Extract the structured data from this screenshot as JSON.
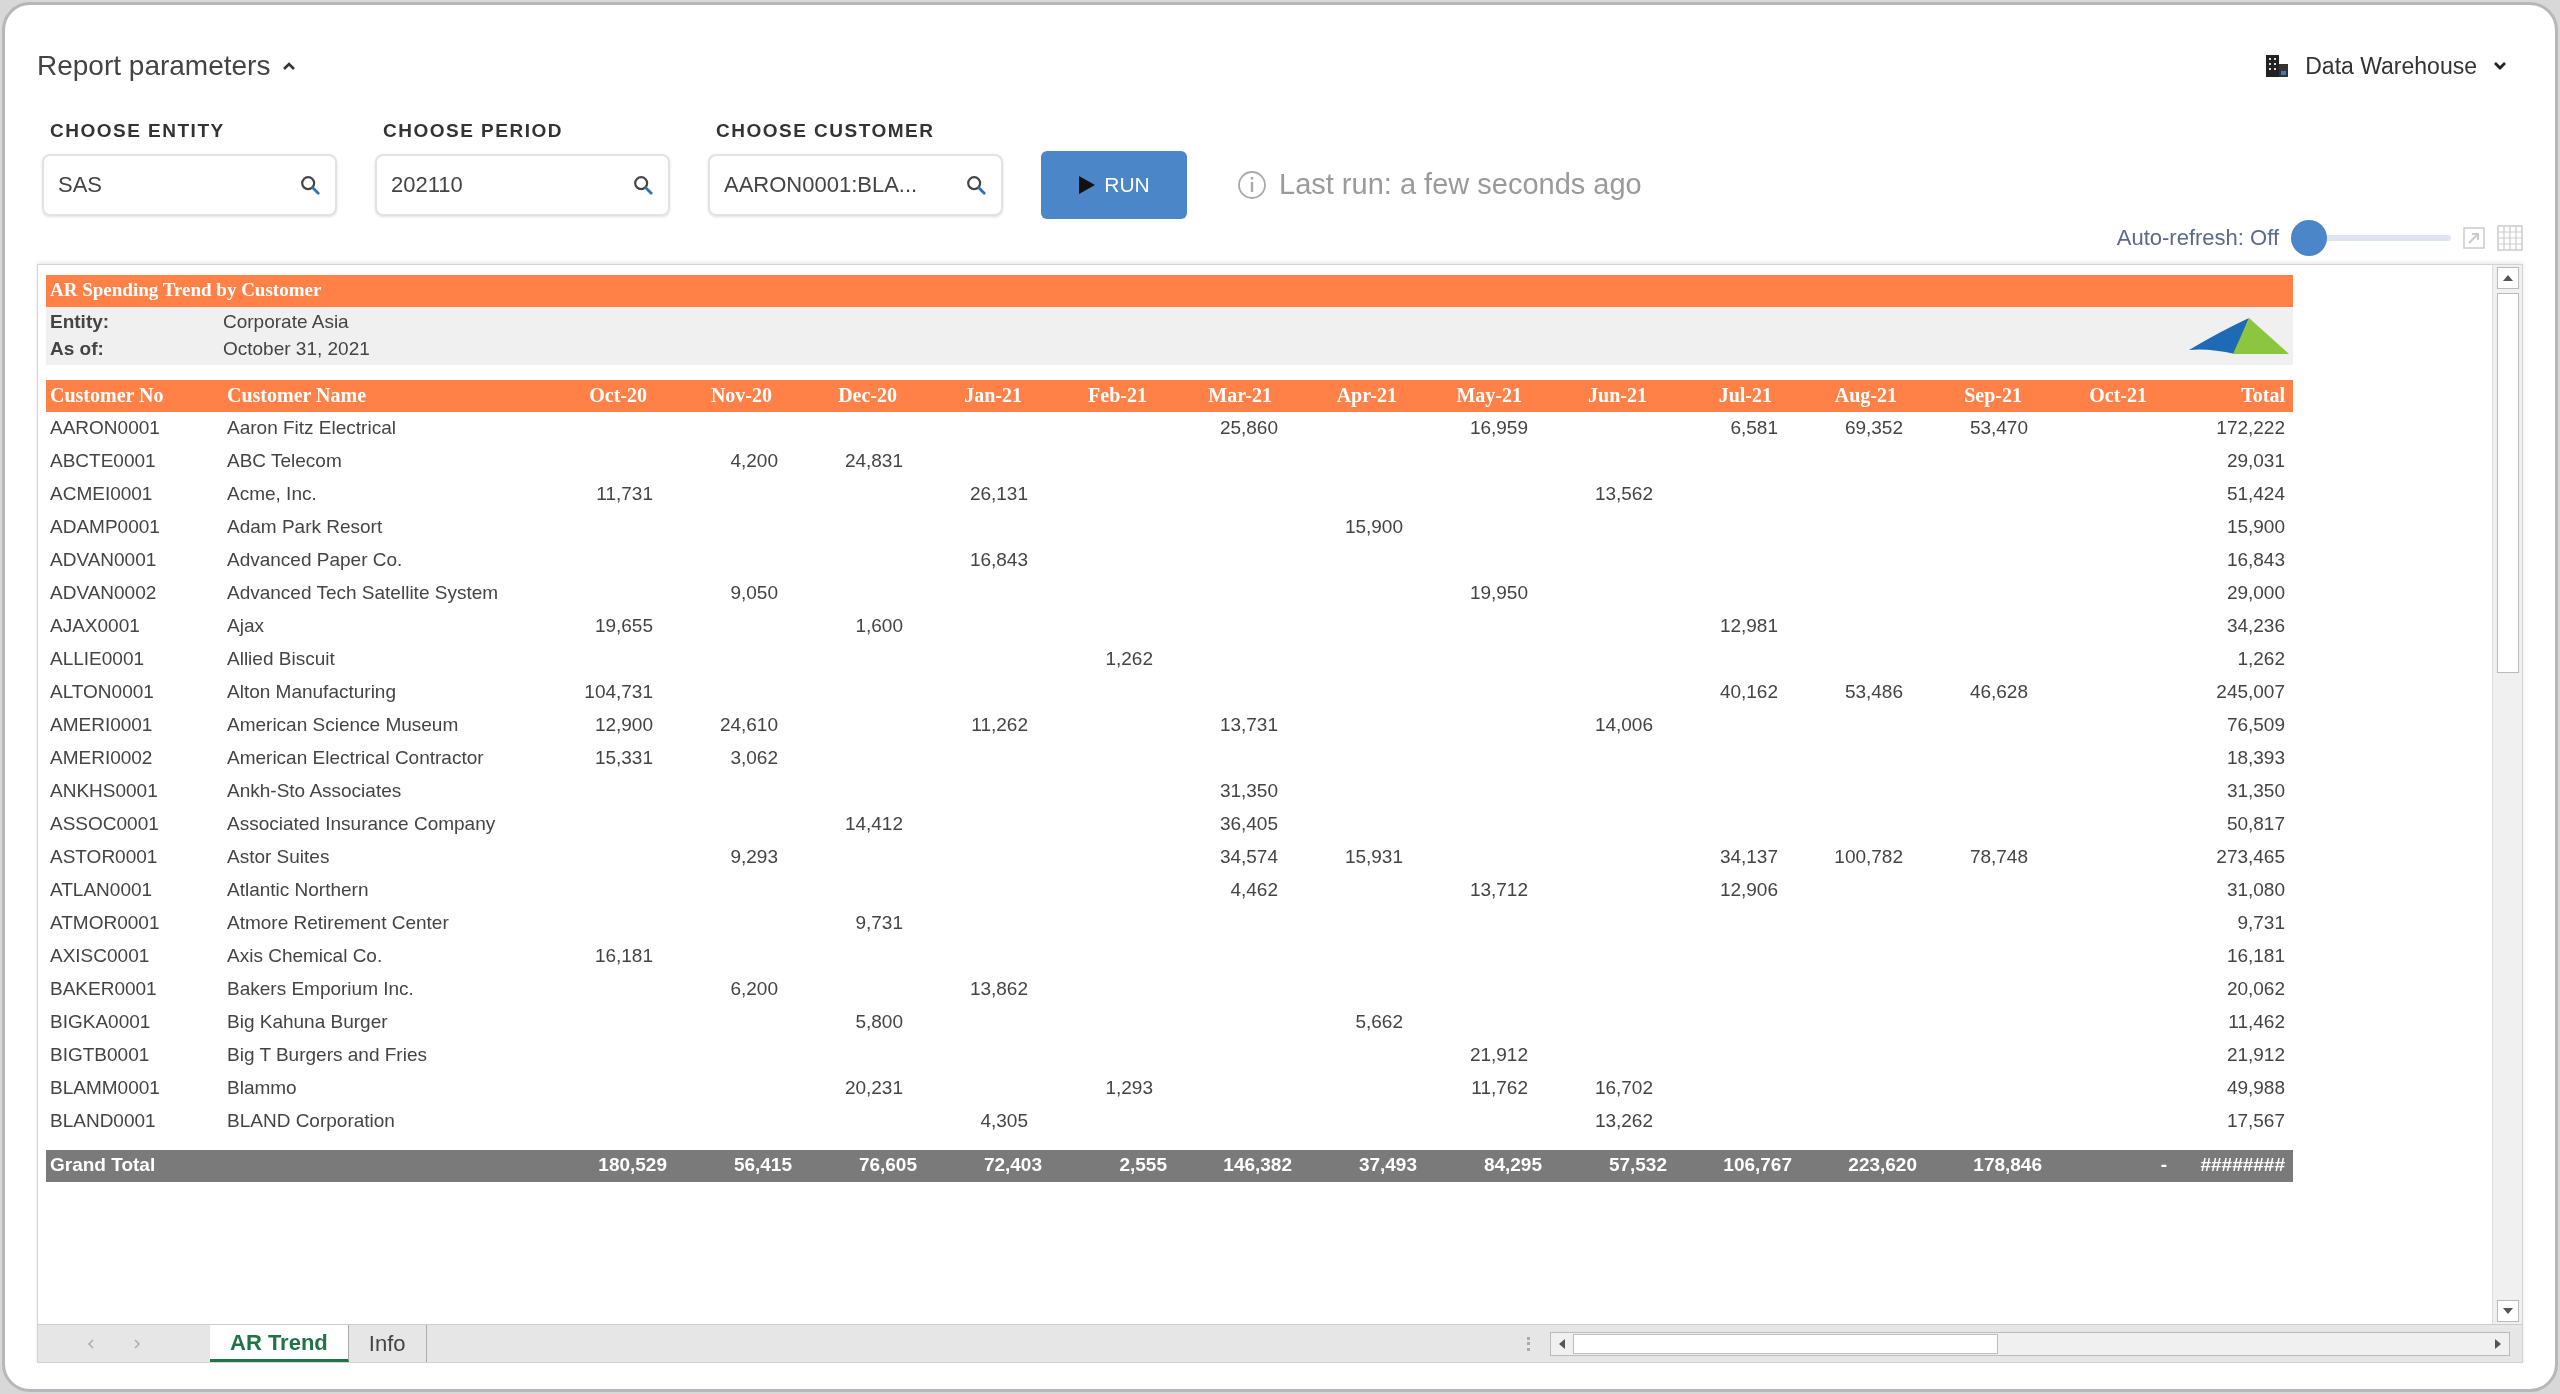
{
  "header": {
    "title": "Report parameters",
    "expanded": true,
    "source": "Data Warehouse"
  },
  "parameters": [
    {
      "label": "CHOOSE ENTITY",
      "value": "SAS"
    },
    {
      "label": "CHOOSE PERIOD",
      "value": "202110"
    },
    {
      "label": "CHOOSE CUSTOMER",
      "value": "AARON0001:BLA..."
    }
  ],
  "run_button": "RUN",
  "last_run": "Last run: a few seconds ago",
  "auto_refresh": {
    "label": "Auto-refresh: Off",
    "on": false
  },
  "report": {
    "title": "AR Spending Trend by Customer",
    "info": [
      {
        "label": "Entity:",
        "value": "Corporate Asia"
      },
      {
        "label": "As of:",
        "value": "October 31, 2021"
      }
    ],
    "columns": [
      "Customer No",
      "Customer Name",
      "Oct-20",
      "Nov-20",
      "Dec-20",
      "Jan-21",
      "Feb-21",
      "Mar-21",
      "Apr-21",
      "May-21",
      "Jun-21",
      "Jul-21",
      "Aug-21",
      "Sep-21",
      "Oct-21",
      "Total"
    ],
    "rows": [
      [
        "AARON0001",
        "Aaron Fitz Electrical",
        "",
        "",
        "",
        "",
        "",
        "25,860",
        "",
        "16,959",
        "",
        "6,581",
        "69,352",
        "53,470",
        "",
        "172,222"
      ],
      [
        "ABCTE0001",
        "ABC Telecom",
        "",
        "4,200",
        "24,831",
        "",
        "",
        "",
        "",
        "",
        "",
        "",
        "",
        "",
        "",
        "29,031"
      ],
      [
        "ACMEI0001",
        "Acme, Inc.",
        "11,731",
        "",
        "",
        "26,131",
        "",
        "",
        "",
        "",
        "13,562",
        "",
        "",
        "",
        "",
        "51,424"
      ],
      [
        "ADAMP0001",
        "Adam Park Resort",
        "",
        "",
        "",
        "",
        "",
        "",
        "15,900",
        "",
        "",
        "",
        "",
        "",
        "",
        "15,900"
      ],
      [
        "ADVAN0001",
        "Advanced Paper Co.",
        "",
        "",
        "",
        "16,843",
        "",
        "",
        "",
        "",
        "",
        "",
        "",
        "",
        "",
        "16,843"
      ],
      [
        "ADVAN0002",
        "Advanced Tech Satellite System",
        "",
        "9,050",
        "",
        "",
        "",
        "",
        "",
        "19,950",
        "",
        "",
        "",
        "",
        "",
        "29,000"
      ],
      [
        "AJAX0001",
        "Ajax",
        "19,655",
        "",
        "1,600",
        "",
        "",
        "",
        "",
        "",
        "",
        "12,981",
        "",
        "",
        "",
        "34,236"
      ],
      [
        "ALLIE0001",
        "Allied Biscuit",
        "",
        "",
        "",
        "",
        "1,262",
        "",
        "",
        "",
        "",
        "",
        "",
        "",
        "",
        "1,262"
      ],
      [
        "ALTON0001",
        "Alton Manufacturing",
        "104,731",
        "",
        "",
        "",
        "",
        "",
        "",
        "",
        "",
        "40,162",
        "53,486",
        "46,628",
        "",
        "245,007"
      ],
      [
        "AMERI0001",
        "American Science Museum",
        "12,900",
        "24,610",
        "",
        "11,262",
        "",
        "13,731",
        "",
        "",
        "14,006",
        "",
        "",
        "",
        "",
        "76,509"
      ],
      [
        "AMERI0002",
        "American Electrical Contractor",
        "15,331",
        "3,062",
        "",
        "",
        "",
        "",
        "",
        "",
        "",
        "",
        "",
        "",
        "",
        "18,393"
      ],
      [
        "ANKHS0001",
        "Ankh-Sto Associates",
        "",
        "",
        "",
        "",
        "",
        "31,350",
        "",
        "",
        "",
        "",
        "",
        "",
        "",
        "31,350"
      ],
      [
        "ASSOC0001",
        "Associated Insurance Company",
        "",
        "",
        "14,412",
        "",
        "",
        "36,405",
        "",
        "",
        "",
        "",
        "",
        "",
        "",
        "50,817"
      ],
      [
        "ASTOR0001",
        "Astor Suites",
        "",
        "9,293",
        "",
        "",
        "",
        "34,574",
        "15,931",
        "",
        "",
        "34,137",
        "100,782",
        "78,748",
        "",
        "273,465"
      ],
      [
        "ATLAN0001",
        "Atlantic Northern",
        "",
        "",
        "",
        "",
        "",
        "4,462",
        "",
        "13,712",
        "",
        "12,906",
        "",
        "",
        "",
        "31,080"
      ],
      [
        "ATMOR0001",
        "Atmore Retirement Center",
        "",
        "",
        "9,731",
        "",
        "",
        "",
        "",
        "",
        "",
        "",
        "",
        "",
        "",
        "9,731"
      ],
      [
        "AXISC0001",
        "Axis Chemical Co.",
        "16,181",
        "",
        "",
        "",
        "",
        "",
        "",
        "",
        "",
        "",
        "",
        "",
        "",
        "16,181"
      ],
      [
        "BAKER0001",
        "Bakers Emporium Inc.",
        "",
        "6,200",
        "",
        "13,862",
        "",
        "",
        "",
        "",
        "",
        "",
        "",
        "",
        "",
        "20,062"
      ],
      [
        "BIGKA0001",
        "Big Kahuna Burger",
        "",
        "",
        "5,800",
        "",
        "",
        "",
        "5,662",
        "",
        "",
        "",
        "",
        "",
        "",
        "11,462"
      ],
      [
        "BIGTB0001",
        "Big T Burgers and Fries",
        "",
        "",
        "",
        "",
        "",
        "",
        "",
        "21,912",
        "",
        "",
        "",
        "",
        "",
        "21,912"
      ],
      [
        "BLAMM0001",
        "Blammo",
        "",
        "",
        "20,231",
        "",
        "1,293",
        "",
        "",
        "11,762",
        "16,702",
        "",
        "",
        "",
        "",
        "49,988"
      ],
      [
        "BLAND0001",
        "BLAND Corporation",
        "",
        "",
        "",
        "4,305",
        "",
        "",
        "",
        "",
        "13,262",
        "",
        "",
        "",
        "",
        "17,567"
      ]
    ],
    "grand_total": {
      "label": "Grand Total",
      "cells": [
        "180,529",
        "56,415",
        "76,605",
        "72,403",
        "2,555",
        "146,382",
        "37,493",
        "84,295",
        "57,532",
        "106,767",
        "223,620",
        "178,846",
        "-",
        "########"
      ]
    }
  },
  "sheet_tabs": [
    {
      "label": "AR Trend",
      "selected": true
    },
    {
      "label": "Info",
      "selected": false
    }
  ]
}
